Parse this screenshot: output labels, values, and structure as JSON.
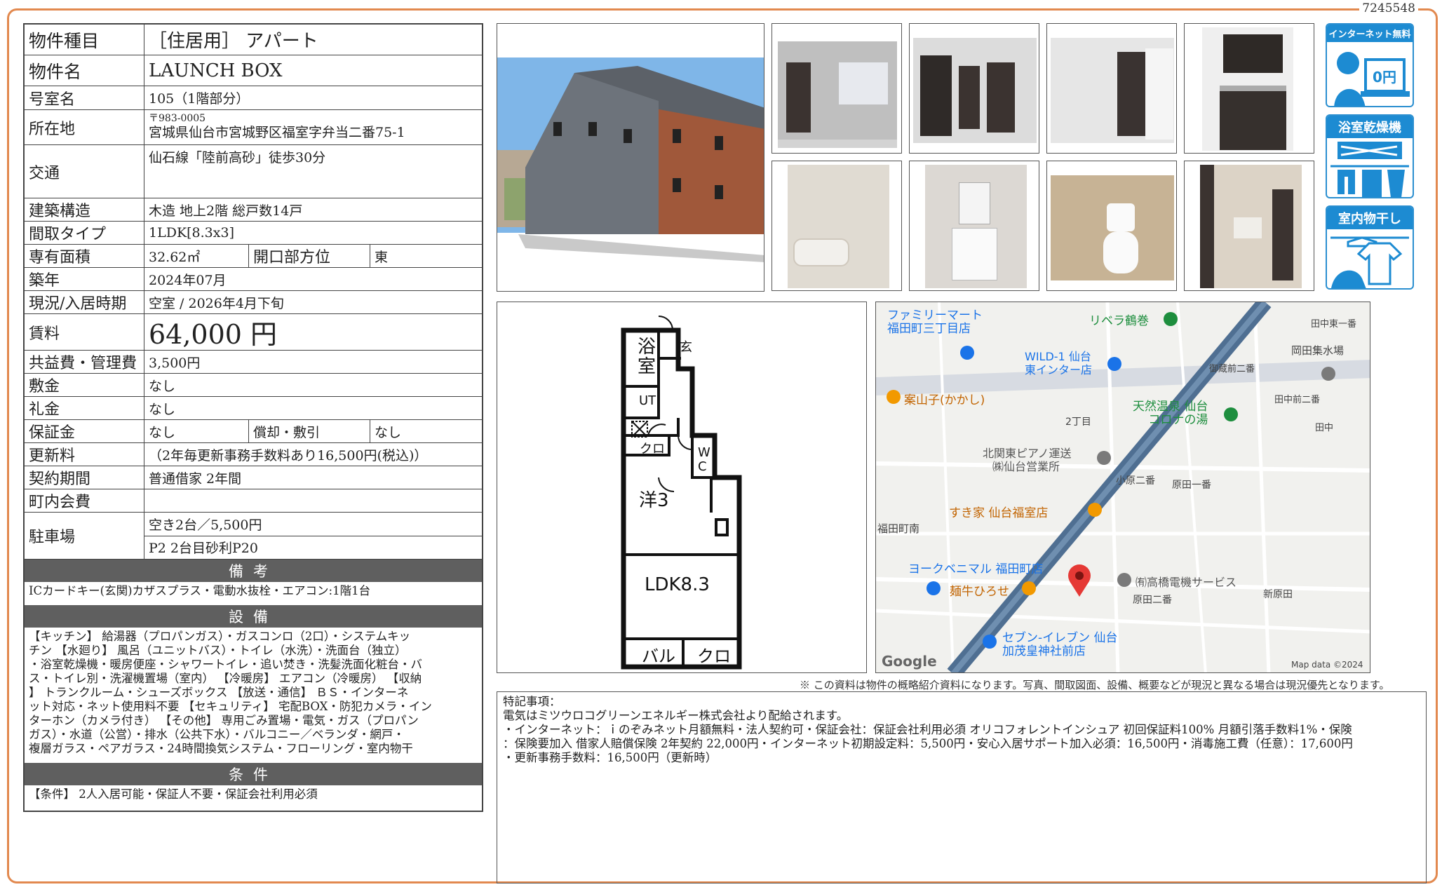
{
  "doc_id": "7245548",
  "property": {
    "rows": [
      {
        "label": "物件種目",
        "value": "［住居用］ アパート"
      },
      {
        "label": "物件名",
        "value": "LAUNCH BOX"
      },
      {
        "label": "号室名",
        "value": "105（1階部分）"
      },
      {
        "label": "所在地",
        "postal": "〒983-0005",
        "value": "宮城県仙台市宮城野区福室字弁当二番75-1"
      },
      {
        "label": "交通",
        "value": "仙石線「陸前高砂」徒歩30分"
      },
      {
        "label": "建築構造",
        "value": "木造 地上2階 総戸数14戸"
      },
      {
        "label": "間取タイプ",
        "value": "1LDK[8.3x3]"
      },
      {
        "label": "専有面積",
        "value": "32.62㎡",
        "label2": "開口部方位",
        "value2": "東"
      },
      {
        "label": "築年",
        "value": "2024年07月"
      },
      {
        "label": "現況/入居時期",
        "value": "空室 / 2026年4月下旬"
      },
      {
        "label": "賃料",
        "value": "64,000 円"
      },
      {
        "label": "共益費・管理費",
        "value": "3,500円"
      },
      {
        "label": "敷金",
        "value": "なし"
      },
      {
        "label": "礼金",
        "value": "なし"
      },
      {
        "label": "保証金",
        "value": "なし",
        "label2": "償却・敷引",
        "value2": "なし"
      },
      {
        "label": "更新料",
        "value": "（2年毎更新事務手数料あり16,500円(税込)）"
      },
      {
        "label": "契約期間",
        "value": "普通借家 2年間"
      },
      {
        "label": "町内会費",
        "value": ""
      },
      {
        "label": "駐車場",
        "value": "空き2台／5,500円",
        "value_b": "P2 2台目砂利P20"
      }
    ]
  },
  "remarks": {
    "title": "備考",
    "text": "ICカードキー(玄関)カザスプラス・電動水抜栓・エアコン:1階1台"
  },
  "facilities": {
    "title": "設備",
    "lines": [
      "【キッチン】 給湯器（プロパンガス）・ガスコンロ（2口）・システムキッ",
      "チン 【水廻り】 風呂（ユニットバス）・トイレ（水洗）・洗面台（独立）",
      "・浴室乾燥機・暖房便座・シャワートイレ・追い焚き・洗髪洗面化粧台・バ",
      "ス・トイレ別・洗濯機置場（室内） 【冷暖房】 エアコン（冷暖房） 【収納",
      "】 トランクルーム・シューズボックス 【放送・通信】 ＢＳ・インターネ",
      "ット対応・ネット使用料不要 【セキュリティ】 宅配BOX・防犯カメラ・イン",
      "ターホン（カメラ付き） 【その他】 専用ごみ置場・電気・ガス（プロパン",
      "ガス）・水道（公営）・排水（公共下水）・バルコニー／ベランダ・網戸・",
      "複層ガラス・ペアガラス・24時間換気システム・フローリング・室内物干"
    ]
  },
  "conditions": {
    "title": "条件",
    "text": "【条件】 2人入居可能・保証人不要・保証会社利用必須"
  },
  "badges": [
    {
      "title": "インターネット無料",
      "icon": "internet-free-icon",
      "caption": "0円"
    },
    {
      "title": "浴室乾燥機",
      "icon": "bathroom-dryer-icon"
    },
    {
      "title": "室内物干し",
      "icon": "indoor-drying-icon"
    }
  ],
  "floor_plan": {
    "rooms": [
      "浴室",
      "玄",
      "UT",
      "クロ",
      "W C",
      "洋3",
      "LDK8.3",
      "バル",
      "クロ"
    ]
  },
  "map": {
    "labels": [
      "ファミリーマート",
      "福田町三丁目店",
      "リベラ鶴巻",
      "田中東一番",
      "WILD-1 仙台",
      "東インター店",
      "岡田集水場",
      "御蔵前二番",
      "案山子(かかし)",
      "田中前二番",
      "天然温泉 仙台",
      "コロナの湯",
      "2丁目",
      "田中",
      "北関東ピアノ運送",
      "㈱仙台営業所",
      "小原二番",
      "原田一番",
      "すき家 仙台福室店",
      "福田町南",
      "ヨークベニマル 福田町店",
      "麺牛ひろせ",
      "㈲高橋電機サービス",
      "原田二番",
      "新原田",
      "セブン-イレブン 仙台",
      "加茂皇神社前店",
      "Google",
      "Map data ©2024"
    ]
  },
  "disclaimer": "※ この資料は物件の概略紹介資料になります。写真、間取図面、設備、概要などが現況と異なる場合は現況優先となります。",
  "notes": {
    "lines": [
      "特記事項：",
      "電気はミツウロコグリーンエネルギー株式会社より配給されます。",
      "・インターネット：ｉのぞみネット月額無料・法人契約可・保証会社：保証会社利用必須 オリコフォレントインシュア 初回保証料100% 月額引落手数料1%・保険",
      "：保険要加入 借家人賠償保険 2年契約 22,000円・インターネット初期設定料：5,500円・安心入居サポート加入必須：16,500円・消毒施工費（任意）：17,600円",
      "・更新事務手数料：16,500円（更新時）"
    ]
  },
  "colors": {
    "frame": "#e2894f",
    "section_bar": "#5f5f5f",
    "badge_blue": "#1d8bd2",
    "map_road": "#4f6f92",
    "pin": "#e53935"
  }
}
